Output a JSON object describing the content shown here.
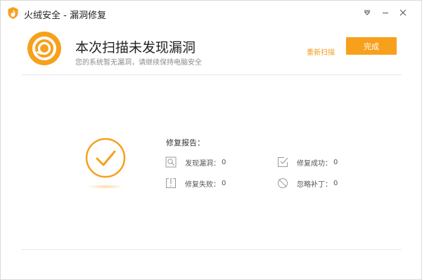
{
  "app": {
    "title": "火绒安全 - 漏洞修复",
    "accent_color": "#f7a01c"
  },
  "window_controls": {
    "menu_icon": "menu-triangle-icon",
    "minimize_icon": "minimize-icon",
    "close_icon": "close-icon"
  },
  "header": {
    "title": "本次扫描未发现漏洞",
    "subtitle": "您的系统暂无漏洞，请继续保持电脑安全",
    "rescan_label": "重新扫描",
    "done_label": "完成"
  },
  "report": {
    "title": "修复报告：",
    "stats": [
      {
        "label": "发现漏洞：",
        "value": "0",
        "icon": "magnifier-icon"
      },
      {
        "label": "修复成功：",
        "value": "0",
        "icon": "checked-doc-icon"
      },
      {
        "label": "修复失败：",
        "value": "0",
        "icon": "alert-box-icon"
      },
      {
        "label": "忽略补丁：",
        "value": "0",
        "icon": "ignore-circle-icon"
      }
    ]
  }
}
